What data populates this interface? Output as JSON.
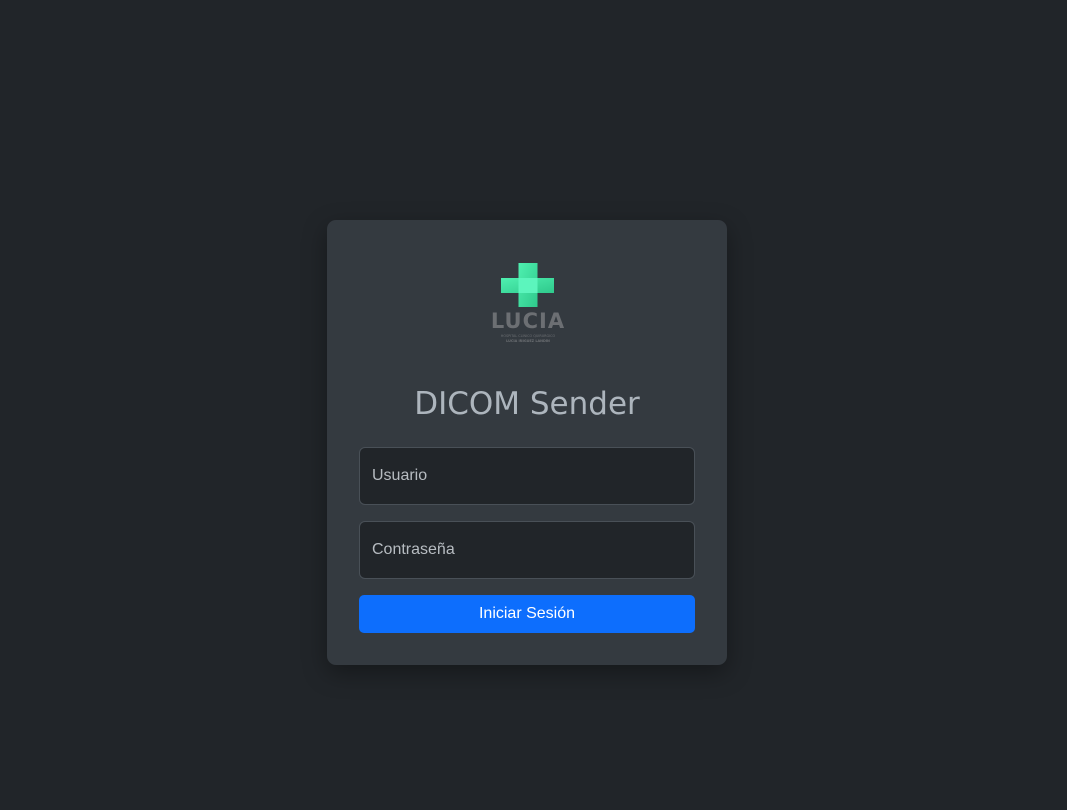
{
  "logo": {
    "name": "LUCIA",
    "subtitle": "HOSPITAL CLÍNICO QUIRÚRGICO",
    "tagline": "LUCÍA IÑIGUEZ LANDÍN",
    "accent_color": "#3ddc9b",
    "icon": "medical-cross-icon"
  },
  "title": "DICOM Sender",
  "form": {
    "username_placeholder": "Usuario",
    "password_placeholder": "Contraseña",
    "submit_label": "Iniciar Sesión",
    "submit_color": "#0d6efd"
  }
}
